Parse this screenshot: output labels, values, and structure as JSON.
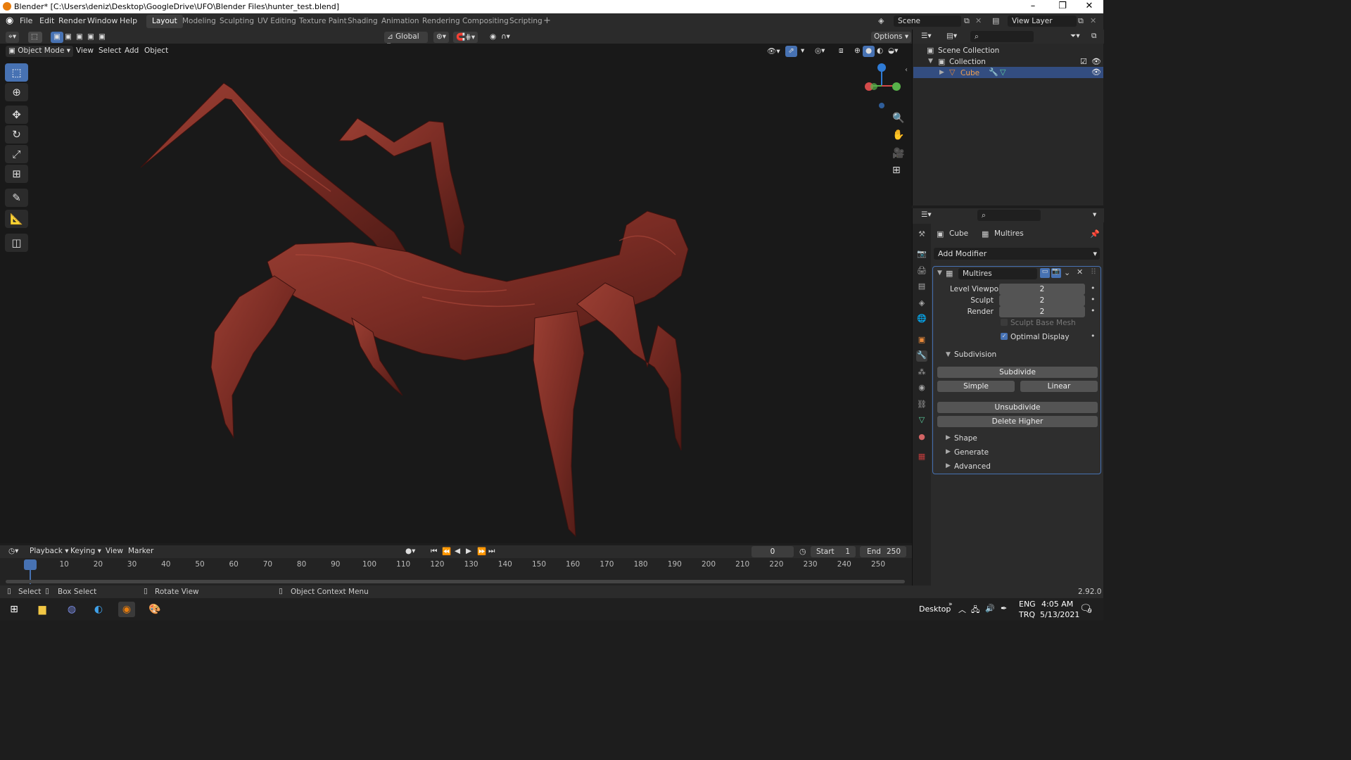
{
  "window": {
    "title": "Blender* [C:\\Users\\deniz\\Desktop\\GoogleDrive\\UFO\\Blender Files\\hunter_test.blend]"
  },
  "menu": [
    "File",
    "Edit",
    "Render",
    "Window",
    "Help"
  ],
  "workspaces": [
    "Layout",
    "Modeling",
    "Sculpting",
    "UV Editing",
    "Texture Paint",
    "Shading",
    "Animation",
    "Rendering",
    "Compositing",
    "Scripting"
  ],
  "active_workspace": "Layout",
  "scene": {
    "label": "Scene",
    "view_layer": "View Layer"
  },
  "viewport_header": {
    "orientation": "Global",
    "options": "Options",
    "mode": "Object Mode",
    "menus": [
      "View",
      "Select",
      "Add",
      "Object"
    ]
  },
  "outliner": {
    "scene_collection": "Scene Collection",
    "collection": "Collection",
    "object": "Cube"
  },
  "properties": {
    "breadcrumb_object": "Cube",
    "breadcrumb_modifier": "Multires",
    "add_modifier": "Add Modifier",
    "modifier_name": "Multires",
    "fields": [
      {
        "label": "Level Viewport",
        "value": "2"
      },
      {
        "label": "Sculpt",
        "value": "2"
      },
      {
        "label": "Render",
        "value": "2"
      }
    ],
    "sculpt_base_mesh": "Sculpt Base Mesh",
    "optimal_display": "Optimal Display",
    "subdivision": "Subdivision",
    "subdivide": "Subdivide",
    "simple": "Simple",
    "linear": "Linear",
    "unsubdivide": "Unsubdivide",
    "delete_higher": "Delete Higher",
    "panels": [
      "Shape",
      "Generate",
      "Advanced"
    ]
  },
  "timeline": {
    "menus": [
      "Playback",
      "Keying",
      "View",
      "Marker"
    ],
    "current_frame": "0",
    "start_label": "Start",
    "start": "1",
    "end_label": "End",
    "end": "250",
    "ticks": [
      "0",
      "10",
      "20",
      "30",
      "40",
      "50",
      "60",
      "70",
      "80",
      "90",
      "100",
      "110",
      "120",
      "130",
      "140",
      "150",
      "160",
      "170",
      "180",
      "190",
      "200",
      "210",
      "220",
      "230",
      "240",
      "250"
    ]
  },
  "status": {
    "select": "Select",
    "box_select": "Box Select",
    "rotate_view": "Rotate View",
    "context_menu": "Object Context Menu",
    "version": "2.92.0"
  },
  "taskbar": {
    "desktop": "Desktop",
    "lang1": "ENG",
    "lang2": "TRQ",
    "time": "4:05 AM",
    "date": "5/13/2021",
    "notif": "9"
  },
  "colors": {
    "accent": "#4772b3",
    "creature": "#7a2c24",
    "bg": "#191919"
  }
}
